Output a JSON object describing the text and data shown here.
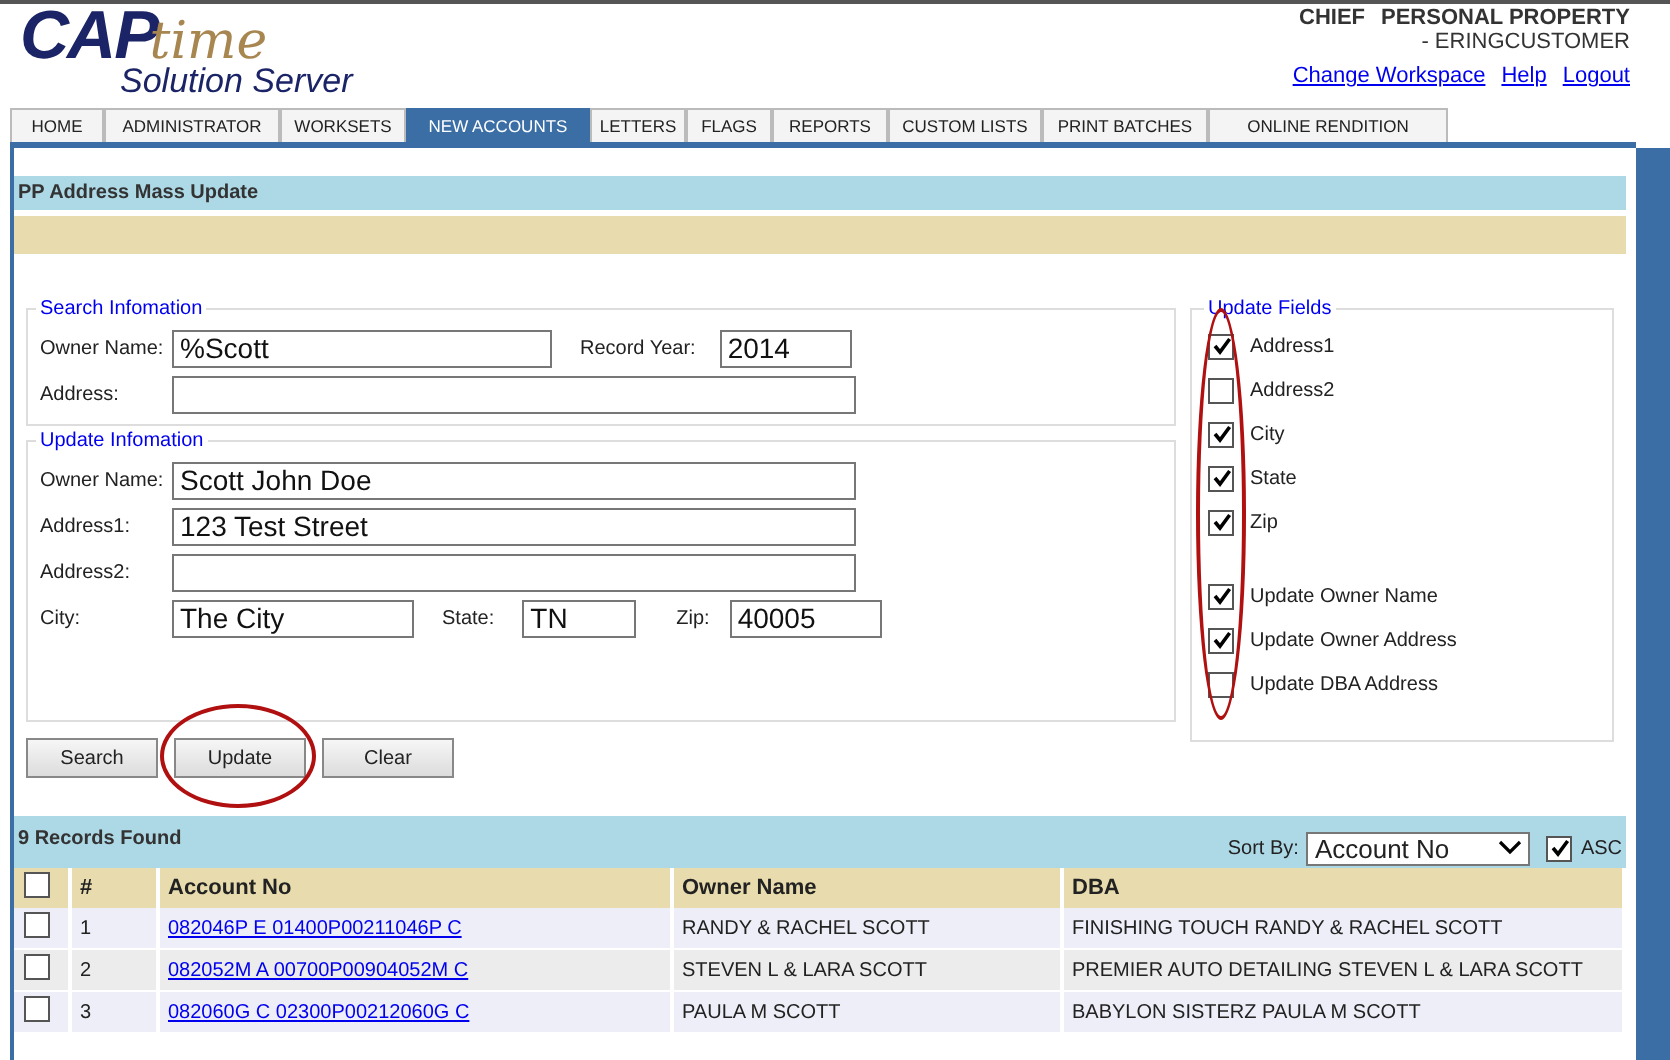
{
  "logo": {
    "main": "CAP",
    "script": "time",
    "sub": "Solution Server"
  },
  "user": {
    "role": "CHIEF",
    "module": "PERSONAL PROPERTY",
    "account": "- ERINGCUSTOMER"
  },
  "header_links": [
    "Change Workspace",
    "Help",
    "Logout"
  ],
  "tabs": [
    {
      "label": "HOME",
      "selected": false
    },
    {
      "label": "ADMINISTRATOR",
      "selected": false
    },
    {
      "label": "WORKSETS",
      "selected": false
    },
    {
      "label": "NEW ACCOUNTS",
      "selected": true
    },
    {
      "label": "LETTERS",
      "selected": false
    },
    {
      "label": "FLAGS",
      "selected": false
    },
    {
      "label": "REPORTS",
      "selected": false
    },
    {
      "label": "CUSTOM LISTS",
      "selected": false
    },
    {
      "label": "PRINT BATCHES",
      "selected": false
    },
    {
      "label": "ONLINE RENDITION",
      "selected": false
    }
  ],
  "page_title": "PP Address Mass Update",
  "search": {
    "legend": "Search Infomation",
    "owner_label": "Owner Name:",
    "owner_value": "%Scott",
    "year_label": "Record Year:",
    "year_value": "2014",
    "address_label": "Address:"
  },
  "update": {
    "legend": "Update Infomation",
    "owner_label": "Owner Name:",
    "owner_value": "Scott John Doe",
    "address1_label": "Address1:",
    "address1_value": "123 Test Street",
    "address2_label": "Address2:",
    "city_label": "City:",
    "city_value": "The City",
    "state_label": "State:",
    "state_value": "TN",
    "zip_label": "Zip:",
    "zip_value": "40005"
  },
  "update_fields": {
    "legend": "Update Fields",
    "circled": true,
    "groups": [
      [
        {
          "label": "Address1",
          "checked": true
        },
        {
          "label": "Address2",
          "checked": false
        },
        {
          "label": "City",
          "checked": true
        },
        {
          "label": "State",
          "checked": true
        },
        {
          "label": "Zip",
          "checked": true
        }
      ],
      [
        {
          "label": "Update Owner Name",
          "checked": true
        },
        {
          "label": "Update Owner Address",
          "checked": true
        },
        {
          "label": "Update DBA Address",
          "checked": false
        }
      ]
    ]
  },
  "buttons": [
    {
      "label": "Search",
      "circled": false
    },
    {
      "label": "Update",
      "circled": true
    },
    {
      "label": "Clear",
      "circled": false
    }
  ],
  "results": {
    "count": "9 Records Found",
    "sort_label": "Sort By:",
    "sort_value": "Account No",
    "asc_label": "ASC",
    "asc_checked": true
  },
  "table": {
    "select_all_checked": false,
    "columns": [
      "#",
      "Account No",
      "Owner Name",
      "DBA"
    ],
    "rows": [
      {
        "checked": false,
        "num": "1",
        "account": "082046P E 01400P00211046P C",
        "owner": "RANDY & RACHEL SCOTT",
        "dba": "FINISHING TOUCH RANDY & RACHEL SCOTT"
      },
      {
        "checked": false,
        "num": "2",
        "account": "082052M A 00700P00904052M C",
        "owner": "STEVEN L & LARA SCOTT",
        "dba": "PREMIER AUTO DETAILING STEVEN L & LARA SCOTT"
      },
      {
        "checked": false,
        "num": "3",
        "account": "082060G C 02300P00212060G C",
        "owner": "PAULA M SCOTT",
        "dba": "BABYLON SISTERZ PAULA M SCOTT"
      }
    ]
  }
}
